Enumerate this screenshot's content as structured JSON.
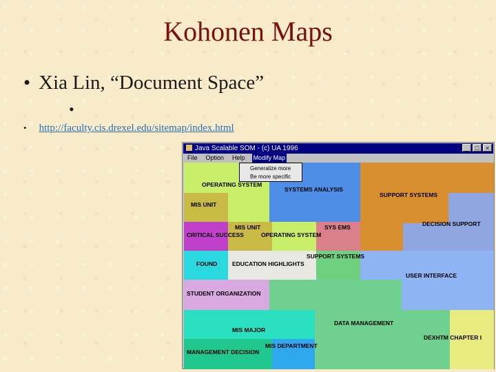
{
  "slide": {
    "title": "Kohonen Maps",
    "bullet_main": "Xia Lin, “Document Space”",
    "bullet_link": "http://faculty.cis.drexel.edu/sitemap/index.html"
  },
  "window": {
    "title": "Java Scalable SOM - (c) UA 1996",
    "minimize": "_",
    "maximize": "□",
    "close": "×",
    "menu": [
      "File",
      "Option",
      "Help",
      "Modify Map"
    ],
    "dropdown": [
      "Generalize more",
      "Be more specific"
    ]
  },
  "map_labels": [
    "OPERATING SYSTEM",
    "SYSTEMS ANALYSIS",
    "SUPPORT SYSTEMS",
    "MIS UNIT",
    "MIS UNIT",
    "SYS EMS",
    "DECISION SUPPORT",
    "CRITICAL SUCCESS",
    "OPERATING SYSTEM",
    "SUPPORT SYSTEMS",
    "FOUND",
    "EDUCATION HIGHLIGHTS",
    "USER INTERFACE",
    "STUDENT ORGANIZATION",
    "DATA MANAGEMENT",
    "MIS MAJOR",
    "DEXHTM CHAPTER I",
    "MIS DEPARTMENT",
    "MANAGEMENT DECISION"
  ],
  "colors": {
    "title": "#7a1010",
    "titlebar": "#000080",
    "link": "#2a6fb0",
    "background": "#f7ebc9"
  }
}
